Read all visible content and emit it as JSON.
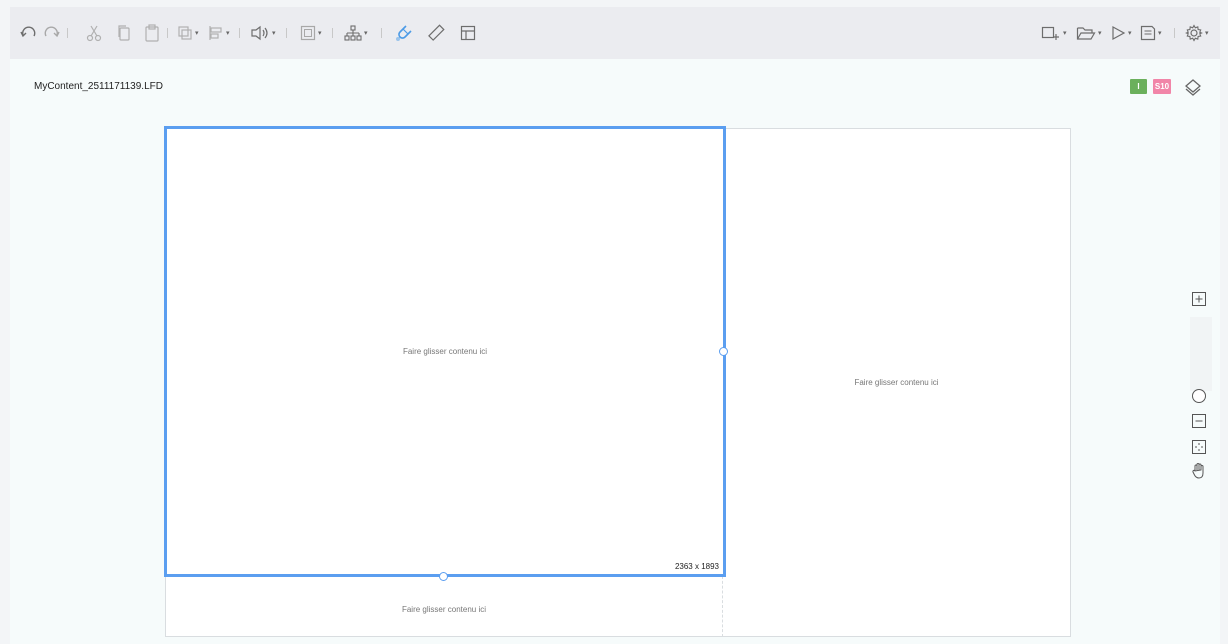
{
  "toolbar": {
    "left": [
      {
        "name": "undo-icon"
      },
      {
        "name": "redo-icon"
      },
      {
        "name": "cut-icon"
      },
      {
        "name": "copy-icon"
      },
      {
        "name": "paste-icon"
      },
      {
        "name": "arrange-icon",
        "dropdown": true
      },
      {
        "name": "align-icon",
        "dropdown": true
      },
      {
        "name": "audio-icon",
        "dropdown": true
      },
      {
        "name": "frame-icon",
        "dropdown": true
      },
      {
        "name": "hierarchy-icon",
        "dropdown": true
      },
      {
        "name": "magnet-icon",
        "active": true
      },
      {
        "name": "ruler-icon"
      },
      {
        "name": "grid-layout-icon"
      }
    ],
    "right": [
      {
        "name": "add-page-icon",
        "dropdown": true
      },
      {
        "name": "open-folder-icon",
        "dropdown": true
      },
      {
        "name": "play-icon",
        "dropdown": true
      },
      {
        "name": "save-icon",
        "dropdown": true
      },
      {
        "name": "settings-icon",
        "dropdown": true
      }
    ],
    "caret": "▾"
  },
  "document": {
    "filename": "MyContent_2511171139.LFD",
    "badge_i": "I",
    "badge_s": "S10"
  },
  "canvas": {
    "main_zone": {
      "label": "Faire glisser contenu ici",
      "dimensions": "2363 x 1893"
    },
    "right_zone": {
      "label": "Faire glisser contenu ici"
    },
    "bottom_zone": {
      "label": "Faire glisser contenu ici"
    }
  },
  "colors": {
    "selection": "#5b9ef0",
    "accent_icon": "#4c9be6",
    "badge_i": "#6bb05c",
    "badge_s": "#f185a8"
  }
}
